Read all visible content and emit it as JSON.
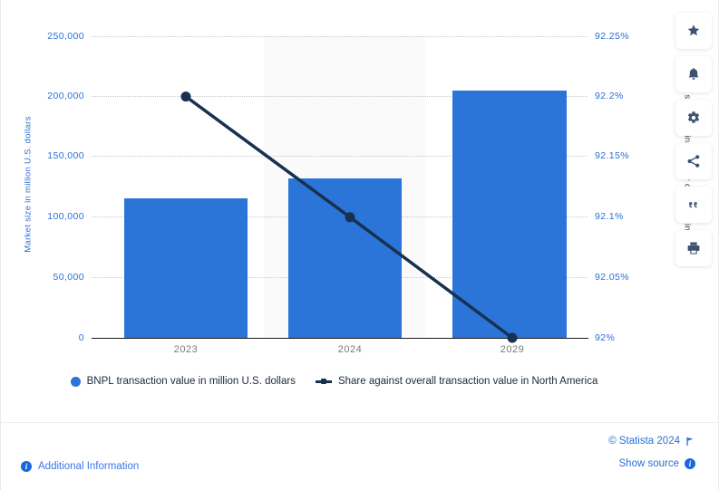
{
  "chart_data": {
    "type": "bar",
    "title": "",
    "categories": [
      "2023",
      "2024",
      "2029"
    ],
    "xlabel": "",
    "ylabel": "Market size in million U.S. dollars",
    "ylabel_right": "Market share against 4 other countries in Europe",
    "ylim": [
      0,
      250000
    ],
    "ylim_right": [
      92,
      92.25
    ],
    "yticks": [
      "0",
      "50,000",
      "100,000",
      "150,000",
      "200,000",
      "250,000"
    ],
    "ytick_values": [
      0,
      50000,
      100000,
      150000,
      200000,
      250000
    ],
    "yticks_right": [
      "92%",
      "92.05%",
      "92.1%",
      "92.15%",
      "92.2%",
      "92.25%"
    ],
    "ytick_values_right": [
      92,
      92.05,
      92.1,
      92.15,
      92.2,
      92.25
    ],
    "grid": true,
    "legend_position": "bottom",
    "series": [
      {
        "name": "BNPL transaction value in million U.S. dollars",
        "type": "bar",
        "axis": "left",
        "color": "#2b75d9",
        "values": [
          115500,
          132000,
          205000
        ]
      },
      {
        "name": "Share against overall transaction value in North America",
        "type": "line",
        "axis": "right",
        "color": "#18314f",
        "values": [
          92.2,
          92.1,
          92.0
        ]
      }
    ]
  },
  "legend": {
    "items": [
      {
        "label": "BNPL transaction value in million U.S. dollars",
        "marker": "dot",
        "color": "#2b75d9"
      },
      {
        "label": "Share against overall transaction value in North America",
        "marker": "line",
        "color": "#18314f"
      }
    ]
  },
  "footer": {
    "additional_information": "Additional Information",
    "copyright": "© Statista 2024",
    "show_source": "Show source",
    "info_glyph": "i"
  },
  "tool_rail": {
    "buttons": [
      {
        "name": "favorite-star-icon",
        "label": "Favorite"
      },
      {
        "name": "notification-bell-icon",
        "label": "Notifications"
      },
      {
        "name": "settings-gear-icon",
        "label": "Settings"
      },
      {
        "name": "share-icon",
        "label": "Share"
      },
      {
        "name": "citation-quote-icon",
        "label": "Cite"
      },
      {
        "name": "print-icon",
        "label": "Print"
      }
    ]
  },
  "colors": {
    "bar": "#2b75d9",
    "line": "#18314f",
    "left_axis_text": "#2b6fd4",
    "right_axis_text": "#2b6fd4",
    "link": "#2b6fd4",
    "band": "#fafafa"
  }
}
